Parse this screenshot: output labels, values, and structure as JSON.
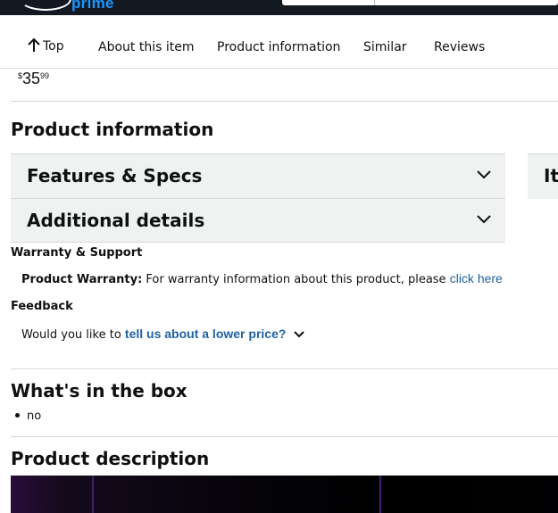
{
  "header": {
    "logo_text": "prime"
  },
  "nav": {
    "items": [
      {
        "label": "Top"
      },
      {
        "label": "About this item"
      },
      {
        "label": "Product information"
      },
      {
        "label": "Similar"
      },
      {
        "label": "Reviews"
      }
    ]
  },
  "price": {
    "symbol": "$",
    "whole": "35",
    "fraction": "99"
  },
  "product_information": {
    "heading": "Product information",
    "accordions": [
      {
        "title": "Features & Specs"
      },
      {
        "title": "Additional details"
      }
    ],
    "side_card_title": "Item details",
    "warranty": {
      "heading": "Warranty & Support",
      "label": "Product Warranty:",
      "text": "For warranty information about this product, please",
      "link": "click here"
    },
    "feedback": {
      "heading": "Feedback",
      "text": "Would you like to",
      "link": "tell us about a lower price?"
    }
  },
  "whats_in_box": {
    "heading": "What's in the box",
    "items": [
      "no"
    ]
  },
  "product_description": {
    "heading": "Product description"
  },
  "colors": {
    "header_bg": "#131921",
    "prime_blue": "#1a98ff",
    "link": "#2162a1",
    "accordion_bg": "#f0f2f2",
    "divider": "#d5d9d9",
    "text": "#0f1111"
  }
}
